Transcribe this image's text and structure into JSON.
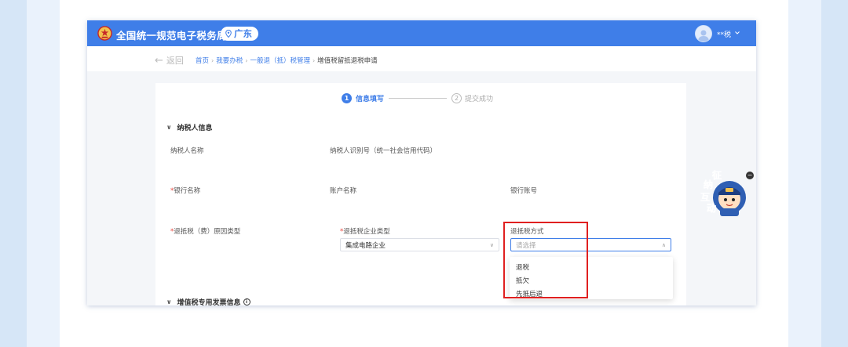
{
  "app": {
    "title": "全国统一规范电子税务局",
    "region": "广东",
    "user_name": "**税"
  },
  "breadcrumb": {
    "back_label": "返回",
    "items": [
      "首页",
      "我要办税",
      "一般退（抵）税管理",
      "增值税留抵退税申请"
    ]
  },
  "steps": [
    {
      "num": "1",
      "label": "信息填写",
      "state": "active"
    },
    {
      "num": "2",
      "label": "提交成功",
      "state": "idle"
    }
  ],
  "sections": {
    "taxpayer_info": "纳税人信息",
    "vat_invoice_info": "增值税专用发票信息"
  },
  "fields": {
    "taxpayer_name": "纳税人名称",
    "taxpayer_id": "纳税人识别号（统一社会信用代码）",
    "bank_name": "银行名称",
    "account_name": "账户名称",
    "bank_account": "银行账号",
    "refund_reason_type": "退抵税（费）原因类型",
    "enterprise_type": "退抵税企业类型",
    "refund_method": "退抵税方式"
  },
  "inputs": {
    "enterprise_type_value": "集成电路企业",
    "refund_method_placeholder": "请选择"
  },
  "dropdown_options": [
    "退税",
    "抵欠",
    "先抵后退"
  ],
  "mascot": {
    "text_chars": [
      "征",
      "纳",
      "互",
      "动"
    ]
  },
  "colors": {
    "primary": "#3f7ee8",
    "highlight": "#e02020",
    "required": "#e8453c"
  }
}
